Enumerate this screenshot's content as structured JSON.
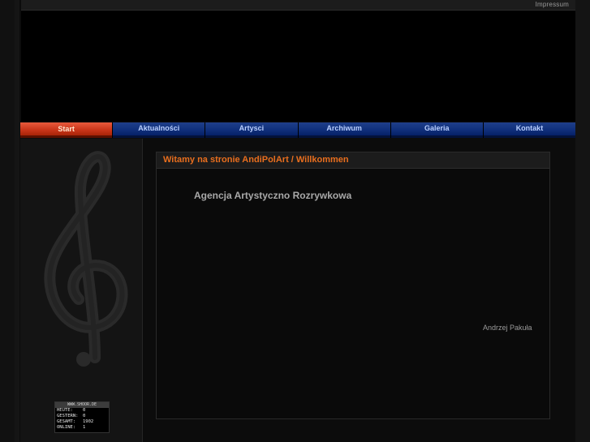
{
  "header": {
    "impressum_label": "Impressum"
  },
  "nav": {
    "items": [
      {
        "label": "Start"
      },
      {
        "label": "Aktualności"
      },
      {
        "label": "Artysci"
      },
      {
        "label": "Archiwum"
      },
      {
        "label": "Galeria"
      },
      {
        "label": "Kontakt"
      }
    ],
    "active_index": 0
  },
  "main": {
    "title": "Witamy na stronie AndiPolArt / Willkommen",
    "subtitle": "Agencja Artystyczno Rozrywkowa",
    "signature": "Andrzej Pakuła"
  },
  "counter": {
    "header": "WWW.SHOOR.DE",
    "rows": [
      {
        "label": "HEUTE:",
        "value": "0"
      },
      {
        "label": "GESTERN:",
        "value": "0"
      },
      {
        "label": "GESAMT:",
        "value": "1902"
      },
      {
        "label": "ONLINE:",
        "value": "1"
      }
    ]
  },
  "colors": {
    "accent": "#e86e1e",
    "nav_blue": "#10307c",
    "nav_active": "#c83418"
  }
}
